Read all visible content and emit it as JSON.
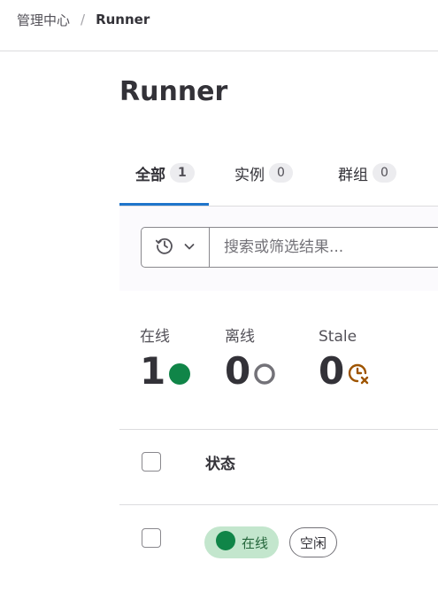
{
  "breadcrumb": {
    "items": [
      "管理中心",
      "Runner"
    ],
    "separator": "/"
  },
  "page": {
    "title": "Runner"
  },
  "tabs": [
    {
      "label": "全部",
      "count": "1",
      "active": true
    },
    {
      "label": "实例",
      "count": "0",
      "active": false
    },
    {
      "label": "群组",
      "count": "0",
      "active": false
    }
  ],
  "filter": {
    "placeholder": "搜索或筛选结果...",
    "history_icon": "history-icon",
    "dropdown_icon": "chevron-down-icon"
  },
  "stats": {
    "online": {
      "label": "在线",
      "value": "1",
      "icon": "status-online-icon",
      "color": "#108548"
    },
    "offline": {
      "label": "离线",
      "value": "0",
      "icon": "status-offline-icon",
      "color": "#737278"
    },
    "stale": {
      "label": "Stale",
      "value": "0",
      "icon": "status-stale-icon",
      "color": "#9e5400"
    }
  },
  "table": {
    "headers": {
      "status": "状态"
    },
    "rows": [
      {
        "status_badge": "在线",
        "idle_badge": "空闲"
      }
    ]
  },
  "colors": {
    "accent": "#1f75cb",
    "online_green": "#108548",
    "online_badge_bg": "#c3e6cd",
    "stale_orange": "#9e5400"
  }
}
